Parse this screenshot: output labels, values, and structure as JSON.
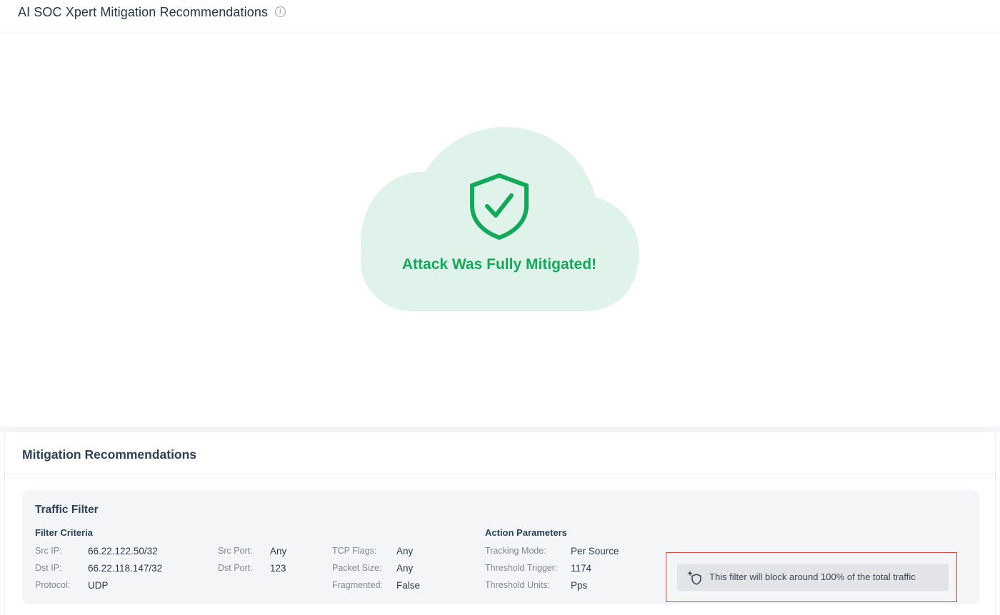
{
  "header": {
    "title": "AI SOC Xpert Mitigation Recommendations",
    "info_icon": "info-icon"
  },
  "status": {
    "message": "Attack Was Fully Mitigated!",
    "icon": "shield-check-icon",
    "accent_color": "#14a85a",
    "cloud_color": "#dff3ea"
  },
  "recommendations": {
    "title": "Mitigation Recommendations",
    "filter": {
      "title": "Traffic Filter",
      "criteria_title": "Filter Criteria",
      "action_title": "Action Parameters",
      "fields": {
        "src_ip": {
          "label": "Src IP:",
          "value": "66.22.122.50/32"
        },
        "dst_ip": {
          "label": "Dst IP:",
          "value": "66.22.118.147/32"
        },
        "protocol": {
          "label": "Protocol:",
          "value": "UDP"
        },
        "src_port": {
          "label": "Src Port:",
          "value": "Any"
        },
        "dst_port": {
          "label": "Dst Port:",
          "value": "123"
        },
        "tcp_flags": {
          "label": "TCP Flags:",
          "value": "Any"
        },
        "packet_size": {
          "label": "Packet Size:",
          "value": "Any"
        },
        "fragmented": {
          "label": "Fragmented:",
          "value": "False"
        }
      },
      "actions": {
        "tracking_mode": {
          "label": "Tracking Mode:",
          "value": "Per Source"
        },
        "threshold_trigger": {
          "label": "Threshold Trigger:",
          "value": "1174"
        },
        "threshold_units": {
          "label": "Threshold Units:",
          "value": "Pps"
        }
      },
      "traffic_note": "This filter will block around 100% of the total traffic",
      "traffic_note_icon": "sparkle-shield-icon",
      "highlight_color": "#e24545"
    }
  }
}
